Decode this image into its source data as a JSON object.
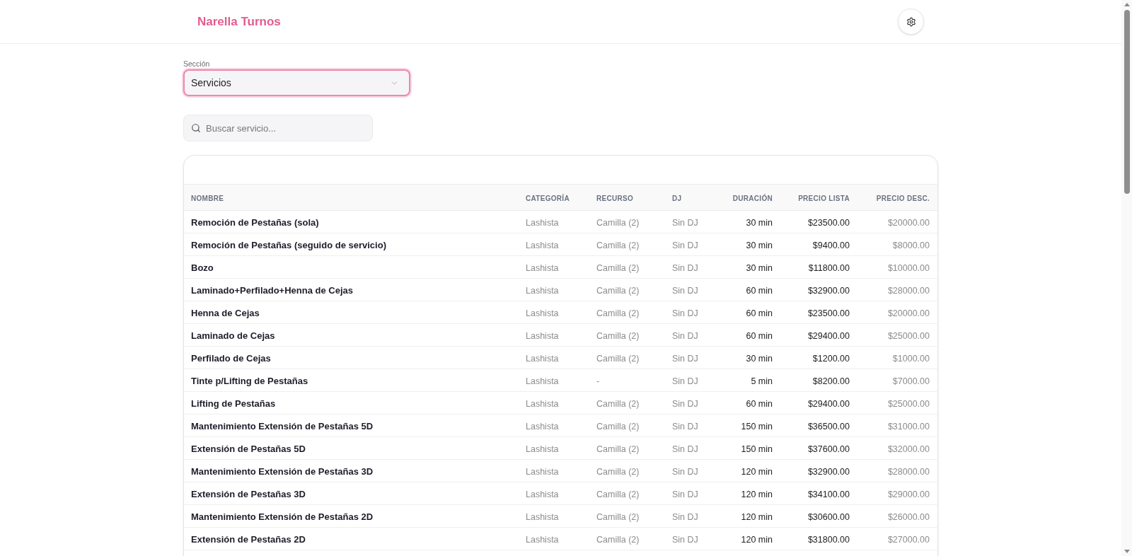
{
  "header": {
    "title": "Narella Turnos"
  },
  "section": {
    "label": "Sección",
    "value": "Servicios",
    "focused": true
  },
  "search": {
    "placeholder": "Buscar servicio..."
  },
  "table": {
    "columns": [
      "NOMBRE",
      "CATEGORÍA",
      "RECURSO",
      "DJ",
      "DURACIÓN",
      "PRECIO LISTA",
      "PRECIO DESC."
    ],
    "rows": [
      [
        "Remoción de Pestañas (sola)",
        "Lashista",
        "Camilla (2)",
        "Sin DJ",
        "30 min",
        "$23500.00",
        "$20000.00"
      ],
      [
        "Remoción de Pestañas (seguido de servicio)",
        "Lashista",
        "Camilla (2)",
        "Sin DJ",
        "30 min",
        "$9400.00",
        "$8000.00"
      ],
      [
        "Bozo",
        "Lashista",
        "Camilla (2)",
        "Sin DJ",
        "30 min",
        "$11800.00",
        "$10000.00"
      ],
      [
        "Laminado+Perfilado+Henna de Cejas",
        "Lashista",
        "Camilla (2)",
        "Sin DJ",
        "60 min",
        "$32900.00",
        "$28000.00"
      ],
      [
        "Henna de Cejas",
        "Lashista",
        "Camilla (2)",
        "Sin DJ",
        "60 min",
        "$23500.00",
        "$20000.00"
      ],
      [
        "Laminado de Cejas",
        "Lashista",
        "Camilla (2)",
        "Sin DJ",
        "60 min",
        "$29400.00",
        "$25000.00"
      ],
      [
        "Perfilado de Cejas",
        "Lashista",
        "Camilla (2)",
        "Sin DJ",
        "30 min",
        "$1200.00",
        "$1000.00"
      ],
      [
        "Tinte p/Lifting de Pestañas",
        "Lashista",
        "-",
        "Sin DJ",
        "5 min",
        "$8200.00",
        "$7000.00"
      ],
      [
        "Lifting de Pestañas",
        "Lashista",
        "Camilla (2)",
        "Sin DJ",
        "60 min",
        "$29400.00",
        "$25000.00"
      ],
      [
        "Mantenimiento Extensión de Pestañas 5D",
        "Lashista",
        "Camilla (2)",
        "Sin DJ",
        "150 min",
        "$36500.00",
        "$31000.00"
      ],
      [
        "Extensión de Pestañas 5D",
        "Lashista",
        "Camilla (2)",
        "Sin DJ",
        "150 min",
        "$37600.00",
        "$32000.00"
      ],
      [
        "Mantenimiento Extensión de Pestañas 3D",
        "Lashista",
        "Camilla (2)",
        "Sin DJ",
        "120 min",
        "$32900.00",
        "$28000.00"
      ],
      [
        "Extensión de Pestañas 3D",
        "Lashista",
        "Camilla (2)",
        "Sin DJ",
        "120 min",
        "$34100.00",
        "$29000.00"
      ],
      [
        "Mantenimiento Extensión de Pestañas 2D",
        "Lashista",
        "Camilla (2)",
        "Sin DJ",
        "120 min",
        "$30600.00",
        "$26000.00"
      ],
      [
        "Extensión de Pestañas 2D",
        "Lashista",
        "Camilla (2)",
        "Sin DJ",
        "120 min",
        "$31800.00",
        "$27000.00"
      ]
    ]
  }
}
